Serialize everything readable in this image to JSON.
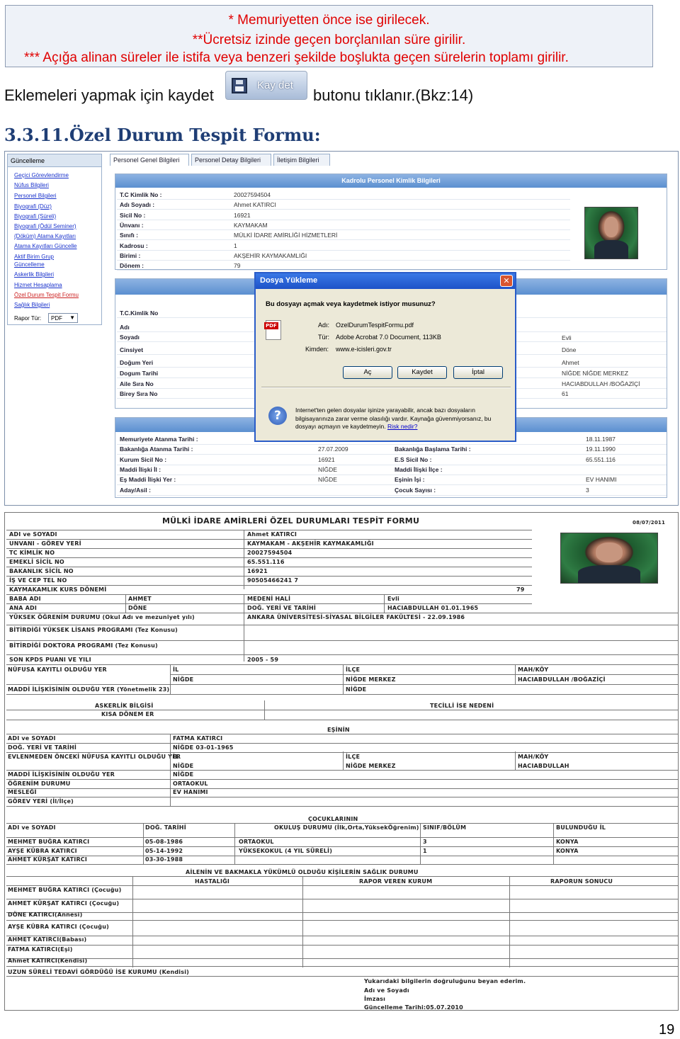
{
  "notes": {
    "line1": "* Memuriyetten önce ise girilecek.",
    "line2": "**Ücretsiz izinde geçen borçlanılan süre girilir.",
    "line3": "*** Açığa alinan süreler ile istifa veya benzeri şekilde boşlukta geçen sürelerin toplamı girilir."
  },
  "doc": {
    "before": "Eklemeleri yapmak için kaydet",
    "button": "Kay det",
    "after": "butonu tıklanır.(Bkz:14)",
    "heading": "3.3.11.Özel Durum Tespit Formu:",
    "page": "19"
  },
  "sidebar": {
    "tab": "Güncelleme",
    "links": [
      "Geçici Görevlendirme",
      "Nüfus Bilgileri",
      "Personel Bilgileri",
      "Biyografi (Düz)",
      "Biyografi (Süreli)",
      "Biyografi (Ödül Seminer)",
      "(Döküm) Atama Kayıtları",
      "Atama Kayıtları Güncelle",
      "Aktif Birim Grup",
      "Güncelleme",
      "Askerlik Bilgileri",
      "Hizmet Hesaplama",
      "Özel Durum Tespit Formu",
      "Sağlık Bilgileri"
    ],
    "rapor_label": "Rapor Tür:",
    "rapor_value": "PDF"
  },
  "tabs": [
    "Personel Genel Bilgileri",
    "Personel Detay Bilgileri",
    "İletişim Bilgileri"
  ],
  "kimlik": {
    "title": "Kadrolu Personel Kimlik Bilgileri",
    "rows": [
      {
        "l": "T.C Kimlik No :",
        "v": "20027594504"
      },
      {
        "l": "Adı Soyadı :",
        "v": "Ahmet KATIRCI"
      },
      {
        "l": "Sicil No :",
        "v": "16921"
      },
      {
        "l": "Ünvanı :",
        "v": "KAYMAKAM"
      },
      {
        "l": "Sınıfı :",
        "v": "MÜLKİ İDARE AMİRLİĞİ HİZMETLERİ"
      },
      {
        "l": "Kadrosu :",
        "v": "1"
      },
      {
        "l": "Birimi :",
        "v": "AKŞEHİR KAYMAKAMLIĞI"
      },
      {
        "l": "Dönem :",
        "v": "79"
      }
    ]
  },
  "nufus": {
    "left": [
      "T.C.Kimlik No",
      "Adı",
      "Soyadı",
      "Cinsiyet",
      "Doğum Yeri",
      "Dogum Tarihi",
      "Aile Sıra No",
      "Birey Sıra No"
    ],
    "right": [
      "Evli",
      "Döne",
      "Ahmet",
      "NİĞDE NİĞDE MERKEZ",
      "HACIABDULLAH /BOĞAZİÇİ",
      "61"
    ]
  },
  "detay": {
    "rows": [
      {
        "l": "Memuriyete Atanma Tarihi :",
        "v": "",
        "l2": "",
        "v2": "18.11.1987"
      },
      {
        "l": "Bakanlığa Atanma Tarihi :",
        "v": "27.07.2009",
        "l2": "Bakanlığa Başlama Tarihi :",
        "v2": "19.11.1990"
      },
      {
        "l": "Kurum Sicil No :",
        "v": "16921",
        "l2": "E.S Sicil No :",
        "v2": "65.551.116"
      },
      {
        "l": "Maddi İlişki İl :",
        "v": "NİĞDE",
        "l2": "Maddi İlişki İlçe :",
        "v2": ""
      },
      {
        "l": "Eş Maddi İlişki Yer :",
        "v": "NİĞDE",
        "l2": "Eşinin İşi :",
        "v2": "EV HANIMI"
      },
      {
        "l": "Aday/Asil :",
        "v": "",
        "l2": "Çocuk Sayısı :",
        "v2": "3"
      }
    ]
  },
  "dialog": {
    "title": "Dosya Yükleme",
    "question": "Bu dosyayı açmak veya kaydetmek istiyor musunuz?",
    "name_label": "Adı:",
    "name": "OzelDurumTespitFormu.pdf",
    "type_label": "Tür:",
    "type": "Adobe Acrobat 7.0 Document, 113KB",
    "from_label": "Kimden:",
    "from": "www.e-icisleri.gov.tr",
    "open": "Aç",
    "save": "Kaydet",
    "cancel": "İptal",
    "warning": "Internet'ten gelen dosyalar işinize yarayabilir, ancak bazı dosyaların bilgisayarınıza zarar verme olasılığı vardır. Kaynağa güvenmiyorsanız, bu dosyayı açmayın ve kaydetmeyin.",
    "risk": "Risk nedir?"
  },
  "form": {
    "title": "MÜLKİ İDARE AMİRLERİ ÖZEL DURUMLARI TESPİT FORMU",
    "date": "08/07/2011",
    "top": [
      {
        "l": "ADI ve SOYADI",
        "v": "Ahmet KATIRCI"
      },
      {
        "l": "UNVANI - GÖREV YERİ",
        "v": "KAYMAKAM - AKŞEHİR KAYMAKAMLIĞI"
      },
      {
        "l": "TC KİMLİK NO",
        "v": "20027594504"
      },
      {
        "l": "EMEKLİ SİCİL NO",
        "v": "65.551.116"
      },
      {
        "l": "BAKANLIK SİCİL NO",
        "v": "16921"
      },
      {
        "l": "İŞ VE CEP TEL NO",
        "v": "90505466241 7"
      },
      {
        "l": "KAYMAKAMLIK KURS DÖNEMİ",
        "v": "79"
      }
    ],
    "baba_l": "BABA ADI",
    "baba_v": "AHMET",
    "medeni_l": "MEDENİ HALİ",
    "medeni_v": "Evli",
    "ana_l": "ANA ADI",
    "ana_v": "DÖNE",
    "dog_l": "DOĞ. YERİ VE TARİHİ",
    "dog_v": "HACIABDULLAH 01.01.1965",
    "ogr_l": "YÜKSEK ÖĞRENİM DURUMU (Okul Adı ve mezuniyet yılı)",
    "ogr_v": "ANKARA ÜNİVERSİTESİ-SİYASAL BİLGİLER FAKÜLTESİ - 22.09.1986",
    "ylp": "BİTİRDİĞİ YÜKSEK LİSANS PROGRAMI (Tez Konusu)",
    "dp": "BİTİRDİĞİ DOKTORA PROGRAMI (Tez Konusu)",
    "kpds_l": "SON KPDS PUANI VE YILI",
    "kpds_v": "2005 - 59",
    "nufus_l": "NÜFUSA KAYITLI OLDUĞU YER",
    "il": "İL",
    "ilce": "İLÇE",
    "mahkoy": "MAH/KÖY",
    "nufus_il": "NİĞDE",
    "nufus_ilce": "NİĞDE MERKEZ",
    "nufus_mah": "HACIABDULLAH /BOĞAZİÇİ",
    "maddi_l": "MADDİ İLİŞKİSİNİN OLDUĞU YER (Yönetmelik 23)",
    "maddi_v": "NİĞDE",
    "asker_l": "ASKERLİK BİLGİSİ",
    "tecil_l": "TECİLLİ İSE NEDENİ",
    "kisa": "KISA DÖNEM ER",
    "esinin": "EŞİNİN",
    "es": [
      {
        "l": "ADI ve SOYADI",
        "v": "FATMA KATIRCI"
      },
      {
        "l": "DOĞ. YERİ VE TARİHİ",
        "v": "NİĞDE 03-01-1965"
      }
    ],
    "es_nufus_l": "EVLENMEDEN ÖNCEKİ NÜFUSA KAYITLI OLDUĞU YER",
    "es_il": "NİĞDE",
    "es_ilce": "NİĞDE MERKEZ",
    "es_mah": "HACIABDULLAH",
    "es_rest": [
      {
        "l": "MADDİ İLİŞKİSİNİN OLDUĞU YER",
        "v": "NİĞDE"
      },
      {
        "l": "ÖĞRENİM DURUMU",
        "v": "ORTAOKUL"
      },
      {
        "l": "MESLEĞİ",
        "v": "EV HANIMI"
      },
      {
        "l": "GÖREV YERİ (İl/İlçe)",
        "v": ""
      }
    ],
    "cocuk_title": "ÇOCUKLARININ",
    "cocuk_head": [
      "ADI ve SOYADI",
      "DOĞ. TARİHİ",
      "OKULUŞ DURUMU (İlk,Orta,YüksekÖğrenim)",
      "SINIF/BÖLÜM",
      "BULUNDUĞU İL"
    ],
    "cocuklar": [
      [
        "MEHMET BUĞRA KATIRCI",
        "05-08-1986",
        "ORTAOKUL",
        "3",
        "KONYA"
      ],
      [
        "AYŞE KÜBRA KATIRCI",
        "05-14-1992",
        "YÜKSEKOKUL (4 YIL SÜRELİ)",
        "1",
        "KONYA"
      ],
      [
        "AHMET KÜRŞAT KATIRCI",
        "03-30-1988",
        "",
        "",
        ""
      ]
    ],
    "saglik_title": "AİLENİN VE BAKMAKLA YÜKÜMLÜ OLDUĞU KİŞİLERİN SAĞLIK DURUMU",
    "saglik_head": [
      "HASTALIĞI",
      "RAPOR VEREN KURUM",
      "RAPORUN SONUCU"
    ],
    "saglik": [
      "MEHMET BUĞRA KATIRCI (Çocuğu)",
      "AHMET KÜRŞAT KATIRCI (Çocuğu)",
      "DÖNE KATIRCI(Annesi)",
      "AYŞE KÜBRA KATIRCI (Çocuğu)",
      "AHMET KATIRCI(Babası)",
      "FATMA KATIRCI(Eşi)",
      "Ahmet KATIRCI(Kendisi)"
    ],
    "tedavi": "UZUN SÜRELİ TEDAVİ GÖRDÜĞÜ İSE KURUMU (Kendisi)",
    "foot1": "Yukarıdaki bilgilerin doğruluğunu beyan ederim.",
    "foot2": "Adı ve Soyadı",
    "foot3": "İmzası",
    "foot4": "Güncelleme Tarihi:05.07.2010"
  }
}
